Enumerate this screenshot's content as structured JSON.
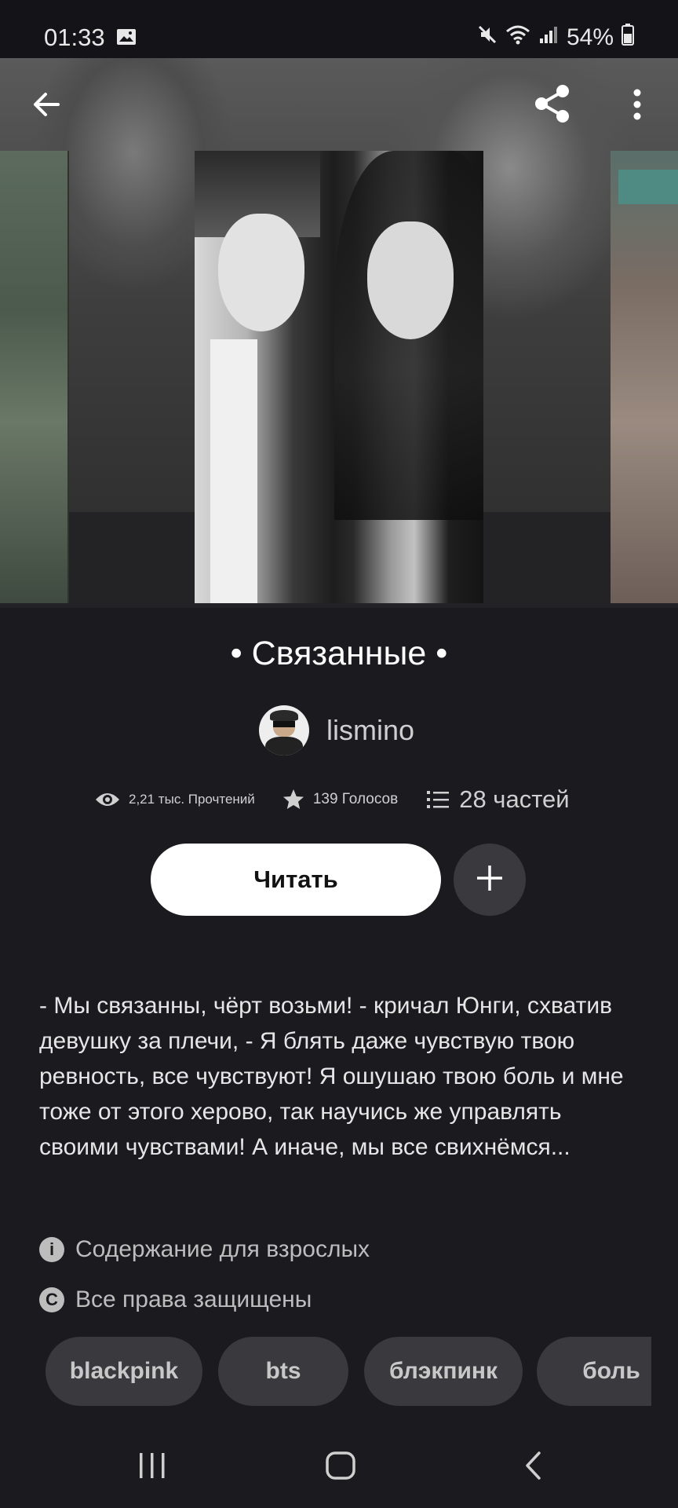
{
  "status_bar": {
    "time": "01:33",
    "battery": "54%",
    "icons": [
      "image-icon",
      "mute-icon",
      "wifi-icon",
      "signal-icon",
      "battery-icon"
    ]
  },
  "toolbar": {
    "back_icon": "back-arrow-icon",
    "share_icon": "share-icon",
    "more_icon": "more-vertical-icon"
  },
  "story": {
    "title": "• Связанные •",
    "author": "lismino",
    "stats": {
      "reads": "2,21 тыс. Прочтений",
      "votes": "139 Голосов",
      "parts": "28 частей"
    },
    "read_button": "Читать",
    "add_icon": "plus-icon",
    "description": "- Мы связанны, чёрт возьми! - кричал Юнги, схватив девушку за плечи, - Я блять даже чувствую твою ревность, все чувствуют! Я ошушаю твою боль и мне тоже от этого херово, так научись же управлять своими чувствами! А иначе, мы все свихнёмся...",
    "mature_label": "Содержание для взрослых",
    "copyright_label": "Все права защищены",
    "tags": [
      "blackpink",
      "bts",
      "блэкпинк",
      "боль"
    ]
  },
  "colors": {
    "background": "#1b1a1f",
    "pill": "#3a393d",
    "button": "#ffffff"
  }
}
